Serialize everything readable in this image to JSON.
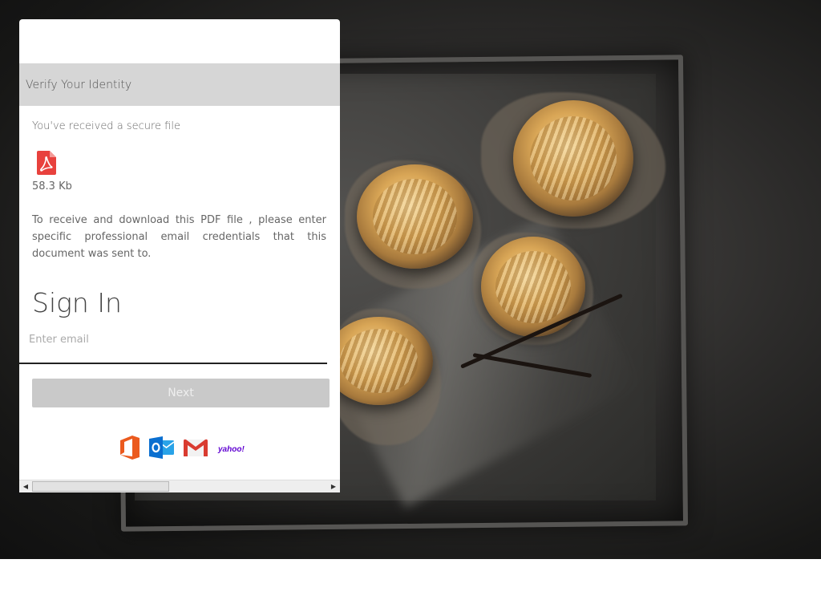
{
  "card": {
    "verify_title": "Verify Your Identity",
    "received_text": "You've received a secure file",
    "file_icon": "pdf-file-icon",
    "file_size": "58.3 Kb",
    "instructions": "To receive and download this PDF file , please enter specific professional email credentials that this document was sent to.",
    "signin_title": "Sign In",
    "email_placeholder": "Enter email",
    "email_value": "",
    "next_label": "Next",
    "providers": [
      "office-icon",
      "outlook-icon",
      "gmail-icon",
      "yahoo-icon"
    ],
    "yahoo_label": "yahoo!"
  },
  "colors": {
    "verify_bar": "#d6d6d6",
    "next_button": "#c9c9c9",
    "pdf_red": "#e8413d",
    "office_orange": "#eb5a1e",
    "outlook_blue": "#0a6fd0",
    "yahoo_purple": "#5f01d1"
  }
}
